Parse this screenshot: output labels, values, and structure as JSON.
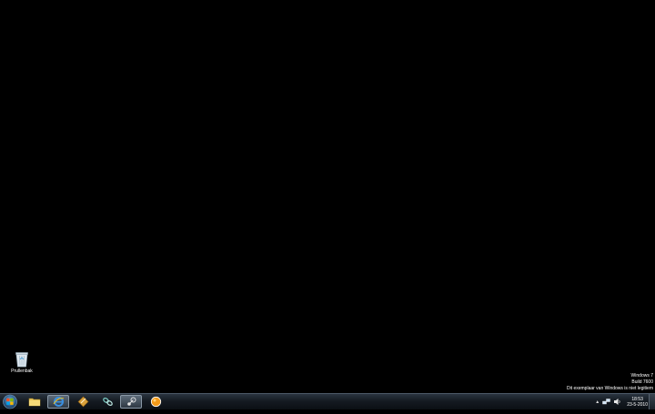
{
  "desktop": {
    "icons": [
      {
        "label": "Prullenbak",
        "icon": "recycle-bin-icon"
      }
    ],
    "watermark": {
      "line1": "Windows 7",
      "line2": "Build 7600",
      "line3": "Dit exemplaar van Windows is niet legitiem"
    }
  },
  "taskbar": {
    "start": {
      "icon": "windows-start-orb-icon"
    },
    "pinned": [
      {
        "icon": "folder-icon"
      },
      {
        "icon": "internet-explorer-icon"
      },
      {
        "icon": "app-diamond-icon"
      },
      {
        "icon": "chain-link-icon"
      },
      {
        "icon": "steam-icon"
      },
      {
        "icon": "orange-orb-icon"
      }
    ],
    "tray": {
      "overflow_arrow": "▲",
      "clock_time": "18:53",
      "clock_date": "23-5-2010"
    }
  },
  "colors": {
    "desktop_bg": "#000000",
    "taskbar_top": "#2a3440",
    "taskbar_bottom": "#0b0f14"
  }
}
